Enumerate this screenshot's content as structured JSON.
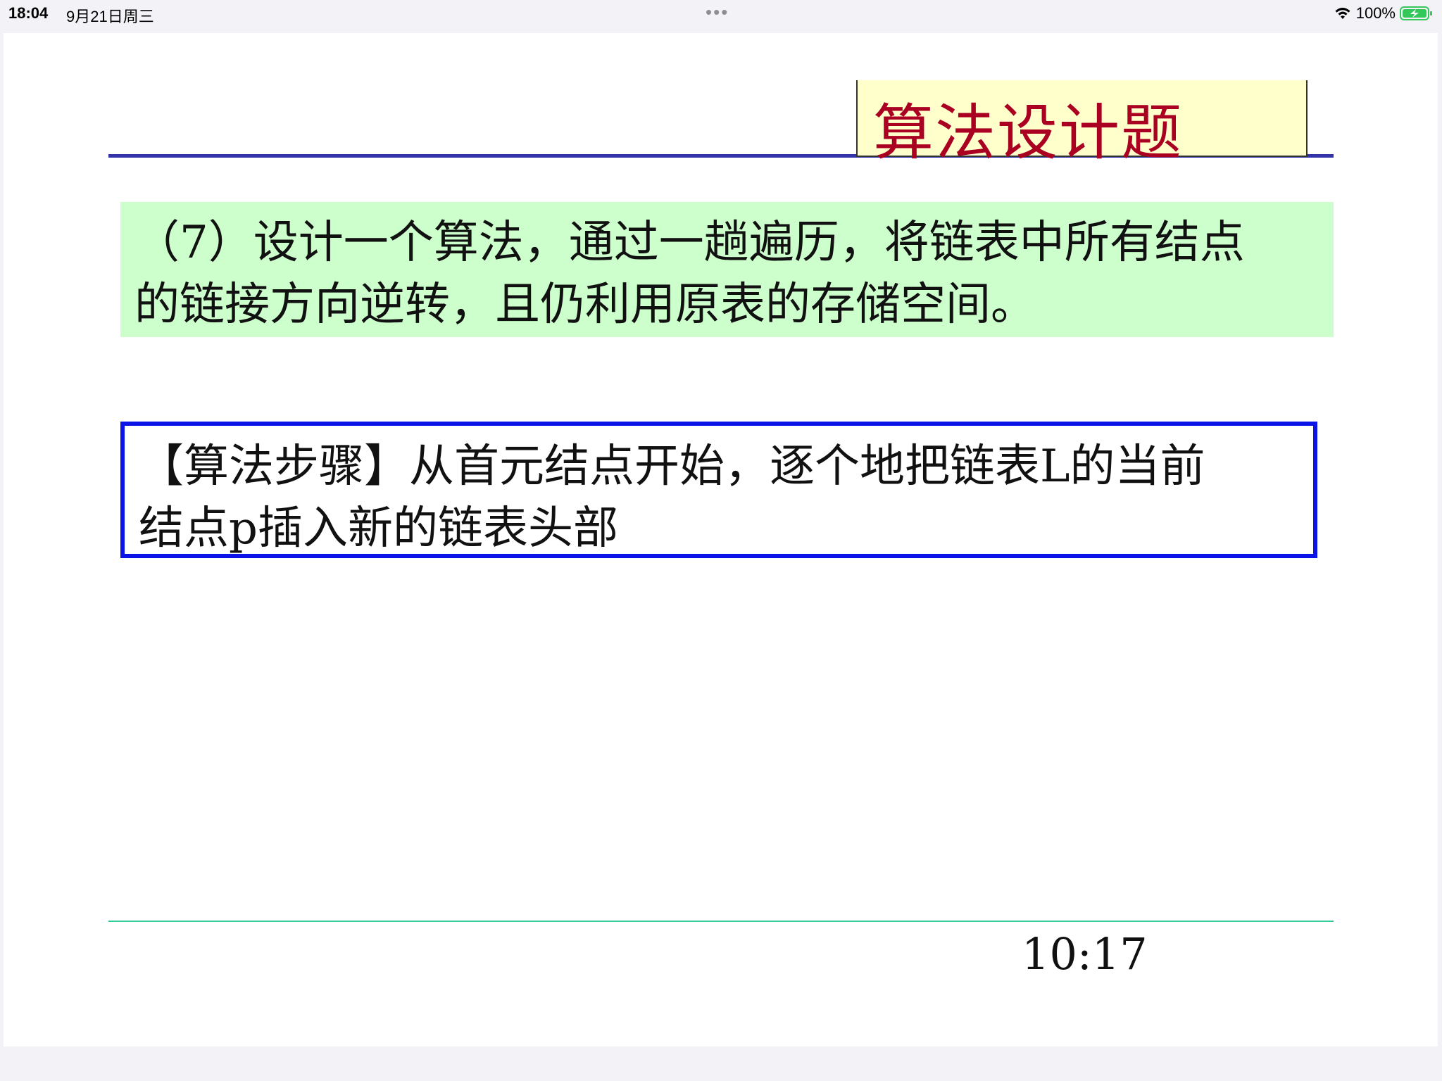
{
  "status_bar": {
    "time": "18:04",
    "date": "9月21日周三",
    "battery": "100%",
    "more_dots": "•••"
  },
  "slide": {
    "title": "算法设计题",
    "question_line1": "（7）设计一个算法，通过一趟遍历，将链表中所有结点",
    "question_line2": "的链接方向逆转，且仍利用原表的存储空间。",
    "steps_line1": "【算法步骤】从首元结点开始，逐个地把链表L的当前",
    "steps_line2": "结点p插入新的链表头部",
    "page_number": "10:17"
  },
  "colors": {
    "title_text": "#aa0022",
    "title_bg": "#ffffcc",
    "title_rule": "#3333aa",
    "question_bg": "#ccffcc",
    "steps_border": "#0a14e6",
    "footer_rule": "#33cc99"
  },
  "icons": {
    "wifi": "wifi-icon",
    "battery": "battery-charging-icon"
  }
}
